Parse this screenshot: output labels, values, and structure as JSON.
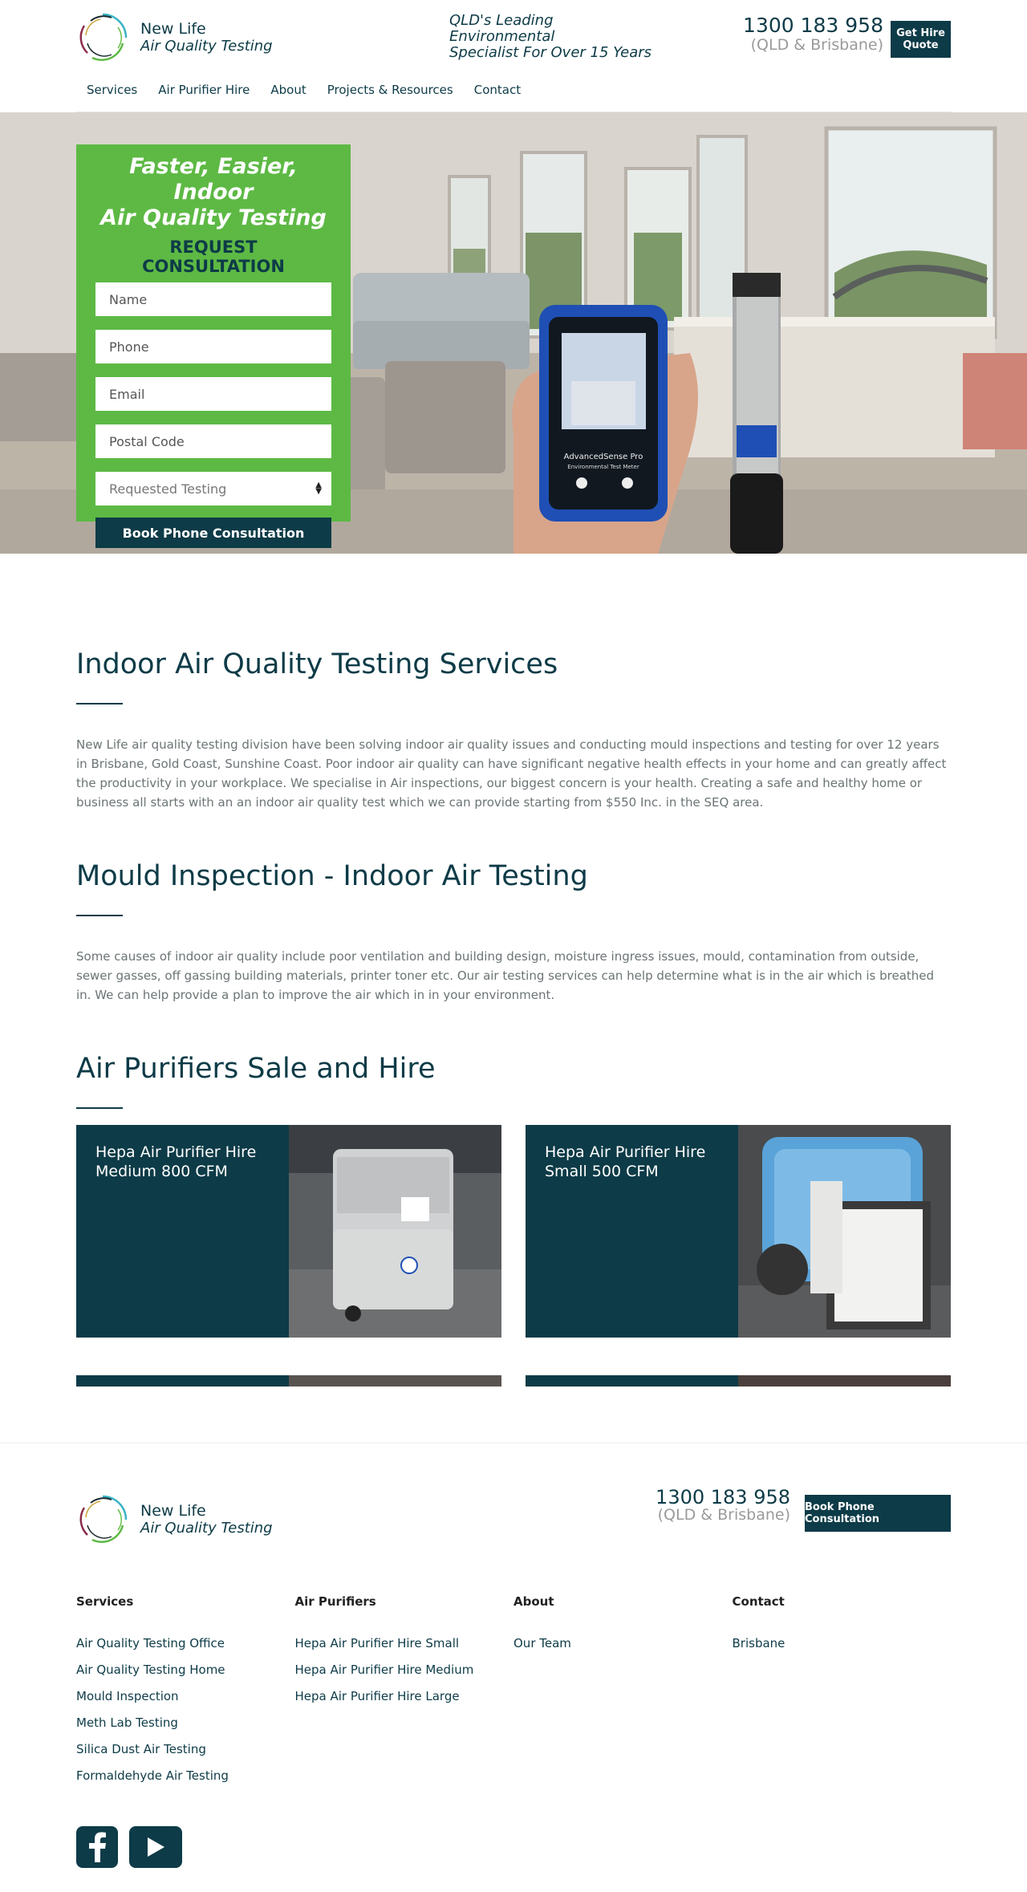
{
  "header": {
    "logo_name": "New Life",
    "logo_sub": "Air Quality Testing",
    "tagline_1": "QLD's Leading",
    "tagline_2": "Environmental",
    "tagline_3": "Specialist For Over 15 Years",
    "phone": "1300 183 958",
    "phone_region": "(QLD & Brisbane)",
    "hire_button_1": "Get Hire",
    "hire_button_2": "Quote"
  },
  "nav": [
    "Services",
    "Air Purifier Hire",
    "About",
    "Projects & Resources",
    "Contact"
  ],
  "hero": {
    "title_1": "Faster, Easier, Indoor",
    "title_2": "Air Quality Testing",
    "subtitle": "REQUEST CONSULTATION",
    "placeholders": {
      "name": "Name",
      "phone": "Phone",
      "email": "Email",
      "postal": "Postal Code"
    },
    "select_value": "Requested Testing",
    "submit": "Book Phone Consultation",
    "device_label_1": "AdvancedSense Pro",
    "device_label_2": "Environmental Test Meter"
  },
  "sections": [
    {
      "title": "Indoor Air Quality Testing Services",
      "body": "New Life air quality testing division have been solving indoor air quality issues and conducting mould inspections and testing for over 12 years in Brisbane, Gold Coast, Sunshine Coast. Poor indoor air quality can have significant negative health effects in your home and can greatly affect the productivity in your workplace. We specialise in Air inspections, our biggest concern is your health. Creating a safe and healthy home or business all starts with an an indoor air quality test which we can provide starting from $550 Inc. in the SEQ area."
    },
    {
      "title": "Mould Inspection - Indoor Air Testing",
      "body": "Some causes of indoor air quality include poor ventilation and building design, moisture ingress issues, mould, contamination from outside, sewer gasses, off gassing building materials, printer toner etc. Our air testing services can help determine what is in the air which is breathed in. We can help provide a plan to improve the air which in in your environment."
    },
    {
      "title": "Air Purifiers Sale and Hire"
    }
  ],
  "cards": [
    {
      "title_1": "Hepa Air Purifier Hire",
      "title_2": "Medium 800 CFM"
    },
    {
      "title_1": "Hepa Air Purifier Hire",
      "title_2": "Small 500 CFM"
    }
  ],
  "footer": {
    "logo_name": "New Life",
    "logo_sub": "Air Quality Testing",
    "phone": "1300 183 958",
    "phone_region": "(QLD & Brisbane)",
    "button": "Book Phone Consultation",
    "columns": [
      {
        "heading": "Services",
        "links": [
          "Air Quality Testing Office",
          "Air Quality Testing Home",
          "Mould Inspection",
          "Meth Lab Testing",
          "Silica Dust Air Testing",
          "Formaldehyde Air Testing"
        ]
      },
      {
        "heading": "Air Purifiers",
        "links": [
          "Hepa Air Purifier Hire Small",
          "Hepa Air Purifier Hire Medium",
          "Hepa Air Purifier Hire Large"
        ]
      },
      {
        "heading": "About",
        "links": [
          "Our Team"
        ]
      },
      {
        "heading": "Contact",
        "links": [
          "Brisbane"
        ]
      }
    ],
    "social": [
      "facebook-icon",
      "youtube-icon"
    ]
  },
  "colors": {
    "brand_dark": "#0d3b47",
    "brand_green": "#5db944",
    "muted_text": "#6b7475"
  }
}
